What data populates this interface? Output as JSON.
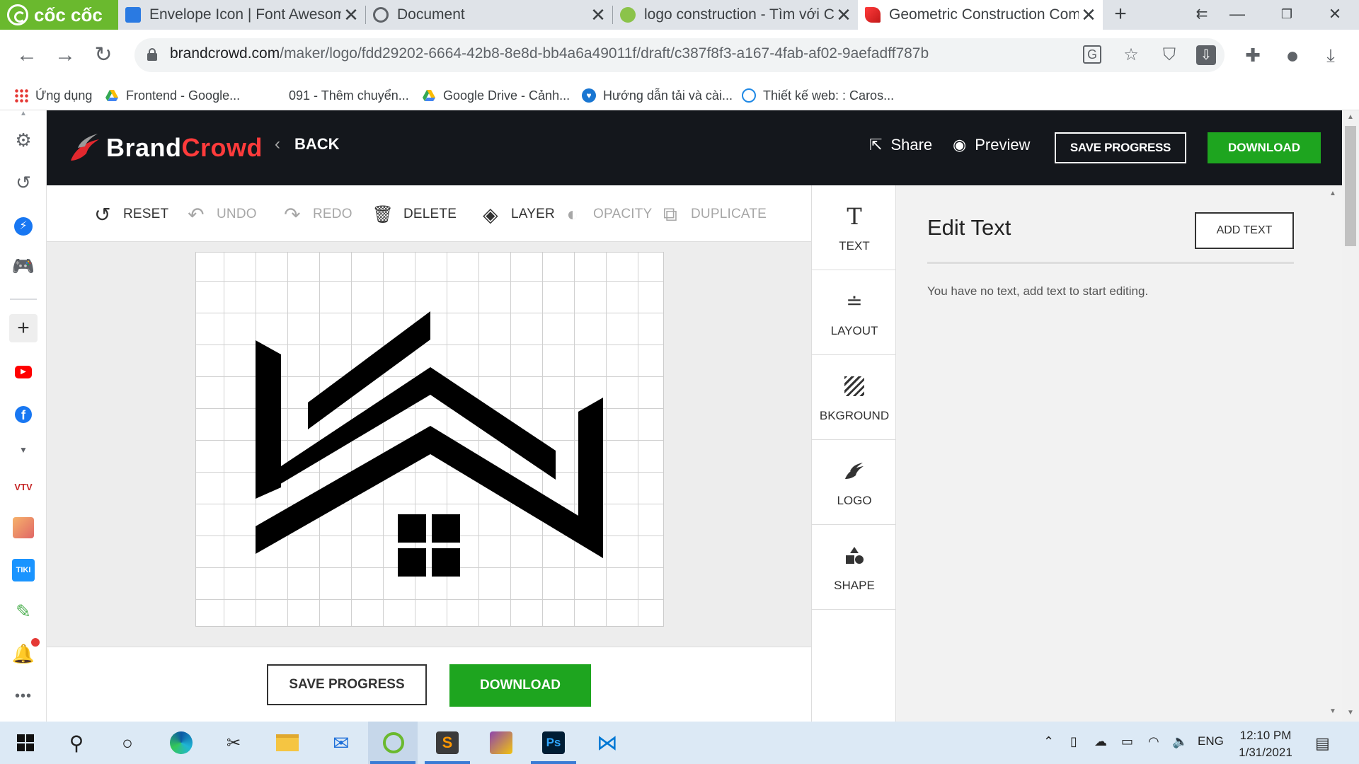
{
  "browser": {
    "brand_label": "cốc cốc",
    "tabs": [
      {
        "title": "Envelope Icon | Font Awesome",
        "active": false
      },
      {
        "title": "Document",
        "active": false
      },
      {
        "title": "logo construction - Tìm với Cốc Cốc",
        "active": false
      },
      {
        "title": "Geometric Construction Company",
        "active": true
      }
    ],
    "new_tab_label": "+",
    "url_host": "brandcrowd.com",
    "url_path": "/maker/logo/fdd29202-6664-42b8-8e8d-bb4a6a49011f/draft/c387f8f3-a167-4fab-af02-9aefadff787b",
    "bookmarks": [
      {
        "label": "Ứng dụng",
        "icon": "apps-grid-icon"
      },
      {
        "label": "Frontend - Google...",
        "icon": "google-drive-icon"
      },
      {
        "label": "091 - Thêm chuyển...",
        "icon": "blank-page-icon"
      },
      {
        "label": "Google Drive - Cảnh...",
        "icon": "google-drive-icon"
      },
      {
        "label": "Hướng dẫn tải và cài...",
        "icon": "heart-icon"
      },
      {
        "label": "Thiết kế web: : Caros...",
        "icon": "globe-icon"
      }
    ]
  },
  "app": {
    "brand_first": "Brand",
    "brand_second": "Crowd",
    "back_label": "BACK",
    "share_label": "Share",
    "preview_label": "Preview",
    "save_progress_label": "SAVE PROGRESS",
    "download_label": "DOWNLOAD",
    "toolbar": {
      "reset": "RESET",
      "undo": "UNDO",
      "redo": "REDO",
      "delete": "DELETE",
      "layer": "LAYER",
      "opacity": "OPACITY",
      "duplicate": "DUPLICATE"
    },
    "side_tools": [
      {
        "label": "TEXT",
        "icon": "text-icon"
      },
      {
        "label": "LAYOUT",
        "icon": "layout-icon"
      },
      {
        "label": "BKGROUND",
        "icon": "background-icon"
      },
      {
        "label": "LOGO",
        "icon": "logo-icon"
      },
      {
        "label": "SHAPE",
        "icon": "shape-icon"
      }
    ],
    "panel": {
      "title": "Edit Text",
      "add_text_label": "ADD TEXT",
      "message": "You have no text, add text to start editing."
    },
    "colors": {
      "header_bg": "#14171c",
      "accent_red": "#ff3b3b",
      "download_green": "#1ea51f"
    }
  },
  "taskbar": {
    "time": "12:10 PM",
    "date": "1/31/2021",
    "language": "ENG"
  }
}
